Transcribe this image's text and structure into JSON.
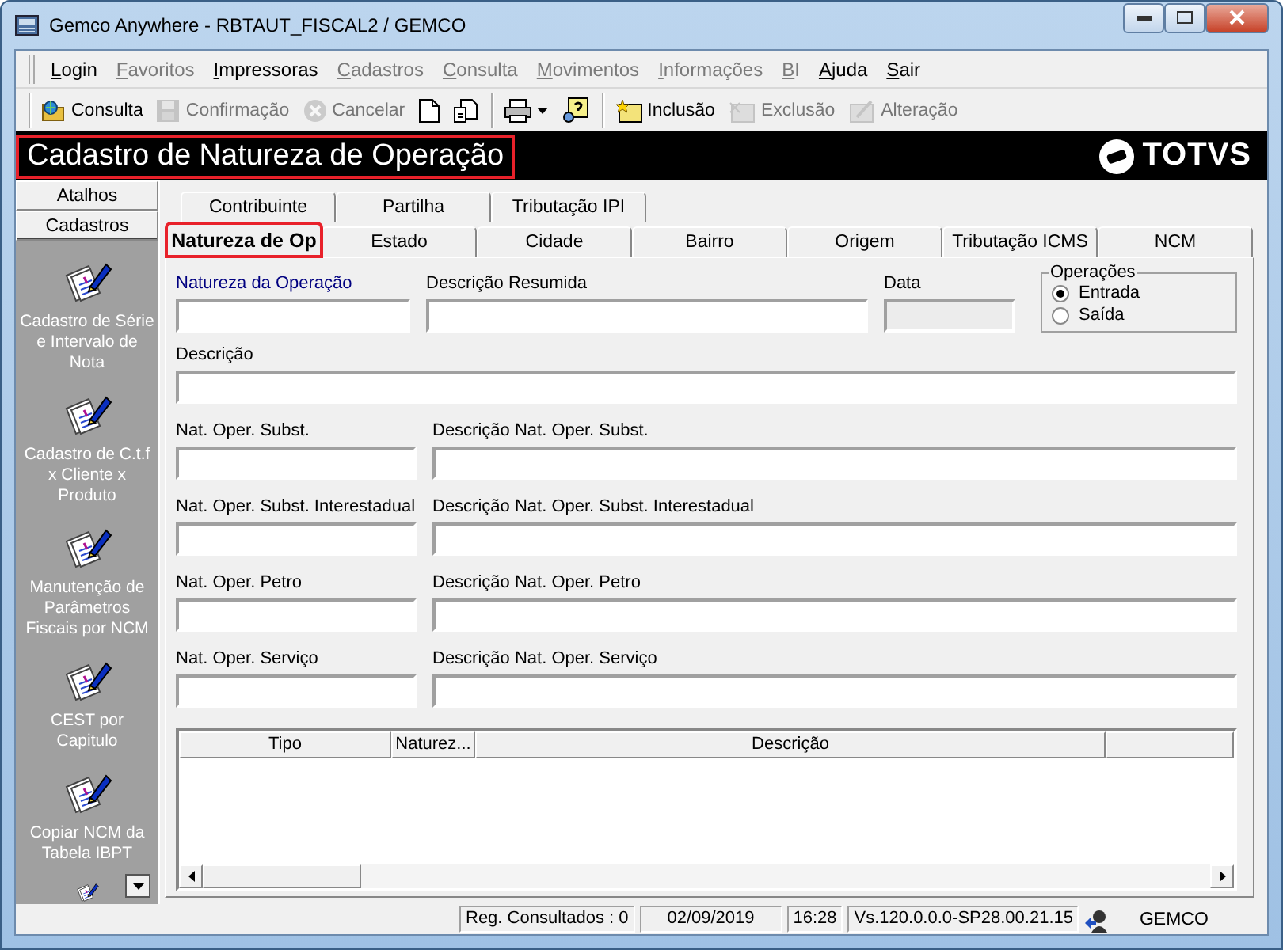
{
  "window": {
    "title": "Gemco Anywhere - RBTAUT_FISCAL2 / GEMCO"
  },
  "menu": [
    {
      "label": "Login",
      "disabled": false
    },
    {
      "label": "Favoritos",
      "disabled": true
    },
    {
      "label": "Impressoras",
      "disabled": false
    },
    {
      "label": "Cadastros",
      "disabled": true
    },
    {
      "label": "Consulta",
      "disabled": true
    },
    {
      "label": "Movimentos",
      "disabled": true
    },
    {
      "label": "Informações",
      "disabled": true
    },
    {
      "label": "BI",
      "disabled": true
    },
    {
      "label": "Ajuda",
      "disabled": false
    },
    {
      "label": "Sair",
      "disabled": false
    }
  ],
  "toolbar": [
    [
      {
        "kind": "labeled",
        "label": "Consulta",
        "disabled": false
      },
      {
        "kind": "labeled",
        "label": "Confirmação",
        "disabled": true
      },
      {
        "kind": "labeled",
        "label": "Cancelar",
        "disabled": true
      },
      {
        "kind": "icon",
        "disabled": false
      },
      {
        "kind": "icon",
        "disabled": false
      }
    ],
    [
      {
        "kind": "dropdown",
        "disabled": false
      },
      {
        "kind": "icon",
        "disabled": false
      }
    ],
    [
      {
        "kind": "labeled",
        "label": "Inclusão",
        "disabled": false
      },
      {
        "kind": "labeled",
        "label": "Exclusão",
        "disabled": true
      },
      {
        "kind": "labeled",
        "label": "Alteração",
        "disabled": true
      }
    ]
  ],
  "banner": {
    "title": "Cadastro de Natureza de Operação",
    "highlighted": true,
    "logo": "TOTVS"
  },
  "sidebar": {
    "tabs": [
      {
        "label": "Atalhos",
        "selected": false
      },
      {
        "label": "Cadastros",
        "selected": true
      }
    ],
    "items": [
      "Cadastro de Série e Intervalo de Nota",
      "Cadastro de C.t.f x Cliente x Produto",
      "Manutenção de Parâmetros Fiscais por NCM",
      "CEST por Capitulo",
      "Copiar NCM da Tabela IBPT"
    ]
  },
  "tabs": {
    "rows": [
      [
        {
          "label": "Contribuinte",
          "selected": false
        },
        {
          "label": "Partilha",
          "selected": false
        },
        {
          "label": "Tributação IPI",
          "selected": false
        }
      ],
      [
        {
          "label": "Natureza de Op",
          "selected": true,
          "highlighted": true
        },
        {
          "label": "Estado",
          "selected": false,
          "highlighted": false
        },
        {
          "label": "Cidade",
          "selected": false,
          "highlighted": false
        },
        {
          "label": "Bairro",
          "selected": false,
          "highlighted": false
        },
        {
          "label": "Origem",
          "selected": false,
          "highlighted": false
        },
        {
          "label": "Tributação ICMS",
          "selected": false,
          "highlighted": false
        },
        {
          "label": "NCM",
          "selected": false,
          "highlighted": false
        }
      ]
    ]
  },
  "form": {
    "rows": [
      [
        {
          "label": "Natureza da Operação",
          "required": true,
          "disabled": false
        },
        {
          "label": "Descrição Resumida",
          "required": false,
          "disabled": false
        },
        {
          "label": "Data",
          "required": false,
          "disabled": true
        }
      ],
      [
        {
          "label": "Descrição",
          "required": false,
          "disabled": false
        }
      ],
      [
        {
          "label": "Nat. Oper. Subst.",
          "required": false,
          "disabled": false
        },
        {
          "label": "Descrição Nat. Oper. Subst.",
          "required": false,
          "disabled": false
        }
      ],
      [
        {
          "label": "Nat. Oper. Subst. Interestadual",
          "required": false,
          "disabled": false
        },
        {
          "label": "Descrição Nat. Oper. Subst. Interestadual",
          "required": false,
          "disabled": false
        }
      ],
      [
        {
          "label": "Nat. Oper. Petro",
          "required": false,
          "disabled": false
        },
        {
          "label": "Descrição Nat. Oper. Petro",
          "required": false,
          "disabled": false
        }
      ],
      [
        {
          "label": "Nat. Oper. Serviço",
          "required": false,
          "disabled": false
        },
        {
          "label": "Descrição Nat. Oper. Serviço",
          "required": false,
          "disabled": false
        }
      ]
    ],
    "operations": {
      "title": "Operações",
      "options": [
        {
          "label": "Entrada",
          "selected": true
        },
        {
          "label": "Saída",
          "selected": false
        }
      ]
    }
  },
  "table": {
    "columns": [
      "Tipo",
      "Naturez...",
      "Descrição"
    ]
  },
  "status_bar": [
    "Reg. Consultados : 0",
    "02/09/2019",
    "16:28",
    "Vs.120.0.0.0-SP28.00.21.15",
    "GEMCO"
  ]
}
